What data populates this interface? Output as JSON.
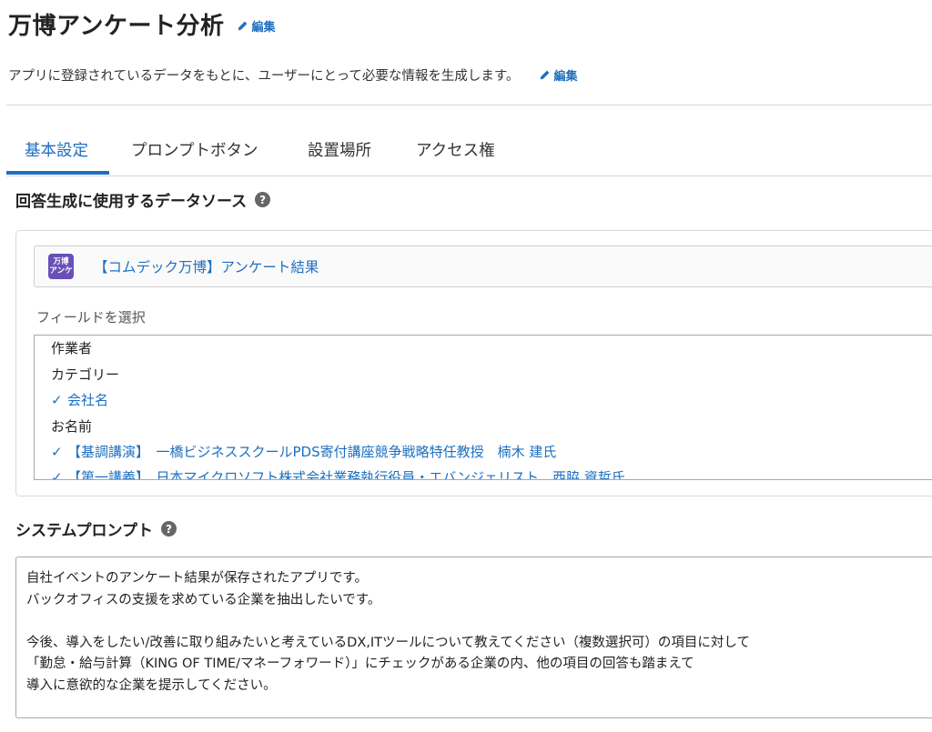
{
  "header": {
    "title": "万博アンケート分析",
    "title_edit_label": "編集",
    "description": "アプリに登録されているデータをもとに、ユーザーにとって必要な情報を生成します。",
    "description_edit_label": "編集"
  },
  "tabs": [
    {
      "label": "基本設定",
      "active": true
    },
    {
      "label": "プロンプトボタン",
      "active": false
    },
    {
      "label": "設置場所",
      "active": false
    },
    {
      "label": "アクセス権",
      "active": false
    }
  ],
  "data_source": {
    "title": "回答生成に使用するデータソース",
    "help_icon": "?",
    "app_icon_text": [
      "万博",
      "アンケ"
    ],
    "app_name": "【コムデック万博】アンケート結果",
    "field_select_label": "フィールドを選択",
    "fields": [
      {
        "label": "作業者",
        "checked": false
      },
      {
        "label": "カテゴリー",
        "checked": false
      },
      {
        "label": "会社名",
        "checked": true
      },
      {
        "label": "お名前",
        "checked": false
      },
      {
        "label": "【基調講演】　一橋ビジネススクールPDS寄付講座競争戦略特任教授　楠木 建氏",
        "checked": true
      },
      {
        "label": "【第一講義】　日本マイクロソフト株式会社業務執行役員・エバンジェリスト　西脇 資哲氏",
        "checked": true
      }
    ]
  },
  "system_prompt": {
    "title": "システムプロンプト",
    "help_icon": "?",
    "lines": [
      "自社イベントのアンケート結果が保存されたアプリです。",
      "バックオフィスの支援を求めている企業を抽出したいです。",
      "",
      "今後、導入をしたい/改善に取り組みたいと考えているDX,ITツールについて教えてください（複数選択可）の項目に対して",
      "「勤怠・給与計算（KING OF TIME/マネーフォワード）」にチェックがある企業の内、他の項目の回答も踏まえて",
      "導入に意欲的な企業を提示してください。"
    ]
  },
  "colors": {
    "accent": "#1e6fbf",
    "app_icon": "#6a4fb8"
  }
}
